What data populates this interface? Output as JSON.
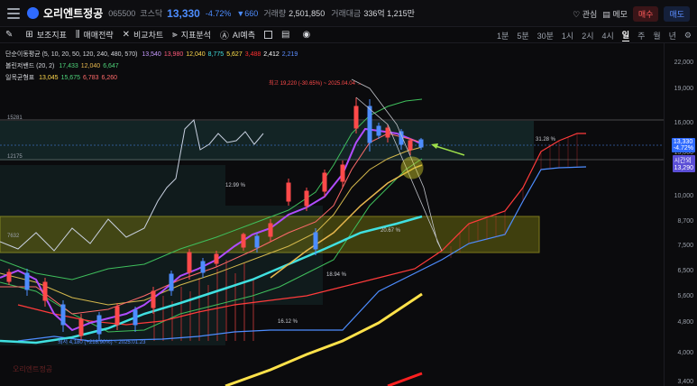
{
  "header": {
    "stock_name": "오리엔트정공",
    "code": "065500",
    "market": "코스닥",
    "price": "13,330",
    "change_pct": "-4.72%",
    "change_abs": "▼660",
    "volume_label": "거래량",
    "volume": "2,501,850",
    "amount_label": "거래대금",
    "amount": "336억 1,215만",
    "interest": "관심",
    "memo": "메모",
    "buy": "매수",
    "sell": "매도"
  },
  "toolbar": {
    "indicators": "보조지표",
    "strategy": "매매전략",
    "compare": "비교차트",
    "analysis": "지표분석",
    "ai": "AI예측"
  },
  "timeframes": [
    "1분",
    "5분",
    "30분",
    "1시",
    "2시",
    "4시",
    "일",
    "주",
    "월",
    "년"
  ],
  "active_timeframe": "일",
  "indicators": {
    "ma": {
      "label": "단순이동평균 (5, 10, 20, 50, 120, 240, 480, 570)",
      "values": [
        "13,540",
        "13,980",
        "12,040",
        "8,775",
        "5,627",
        "3,488",
        "2,412",
        "2,219"
      ],
      "colors": [
        "#c79bff",
        "#ff5a7a",
        "#ffd84d",
        "#40e0e0",
        "#ffe24a",
        "#ff3030",
        "#ffffff",
        "#5b8dff"
      ]
    },
    "bb": {
      "label": "볼린저밴드 (20, 2)",
      "values": [
        "17,433",
        "12,040",
        "6,647"
      ],
      "colors": [
        "#4ed47a",
        "#e8b84e",
        "#4ed47a"
      ]
    },
    "ichimoku": {
      "label": "일목균형표",
      "values": [
        "13,045",
        "15,675",
        "6,783",
        "6,260"
      ],
      "colors": [
        "#ffd84d",
        "#4ed47a",
        "#ff6a6a",
        "#ff6a6a"
      ]
    }
  },
  "annotations": {
    "high": "최고 19,220 (-30.65%) ~ 2025.04.04 →",
    "low": "최저 4,180 (+218.90%) ~ 2025.01.23",
    "level_15281": "15281",
    "level_12175": "12175",
    "level_7632": "7632",
    "pct_1299": "12.99 %",
    "pct_2067": "20.67 %",
    "pct_1894": "18.94 %",
    "pct_1612": "16.12 %",
    "pct_3128": "31.28 %",
    "watermark": "오리엔트정공"
  },
  "price_axis": [
    "22,000",
    "19,000",
    "16,000",
    "13,000",
    "10,000",
    "8,700",
    "7,500",
    "6,500",
    "5,600",
    "4,800",
    "4,000",
    "3,400"
  ],
  "price_tags": {
    "current": "13,330",
    "current_pct": "-4.72%",
    "time_left": "시간외",
    "time_left_price": "13,290"
  }
}
